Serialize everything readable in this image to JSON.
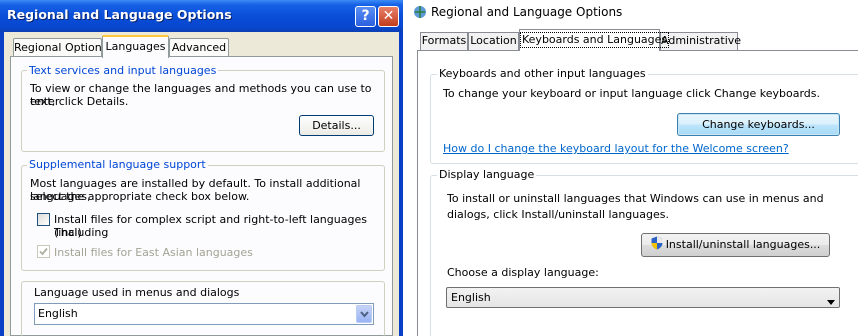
{
  "left_window": {
    "title": "Regional and Language Options",
    "help_label": "?",
    "close_label": "✕",
    "tabs": [
      {
        "label": "Regional Options"
      },
      {
        "label": "Languages"
      },
      {
        "label": "Advanced"
      }
    ],
    "text_services": {
      "legend": "Text services and input languages",
      "description_line1": "To view or change the languages and methods you can use to enter",
      "description_line2": "text, click Details.",
      "details_button": "Details..."
    },
    "supplemental": {
      "legend": "Supplemental language support",
      "description_line1": "Most languages are installed by default. To install additional languages,",
      "description_line2": "select the appropriate check box below.",
      "complex_script_line1": "Install files for complex script and right-to-left languages (including",
      "complex_script_line2": "Thai)",
      "complex_script_checked": false,
      "east_asian": "Install files for East Asian languages",
      "east_asian_checked": true,
      "east_asian_enabled": false
    },
    "menus_language": {
      "label": "Language used in menus and dialogs",
      "selected": "English"
    }
  },
  "right_window": {
    "title": "Regional and Language Options",
    "tabs": [
      {
        "label": "Formats"
      },
      {
        "label": "Location"
      },
      {
        "label": "Keyboards and Languages"
      },
      {
        "label": "Administrative"
      }
    ],
    "keyboards": {
      "legend": "Keyboards and other input languages",
      "description": "To change your keyboard or input language click Change keyboards.",
      "change_button": "Change keyboards...",
      "help_link": "How do I change the keyboard layout for the Welcome screen?"
    },
    "display_language": {
      "legend": "Display language",
      "description_line1": "To install or uninstall languages that Windows can use in menus and",
      "description_line2": "dialogs, click Install/uninstall languages.",
      "install_button": "Install/uninstall languages...",
      "choose_label": "Choose a display language:",
      "selected": "English"
    }
  },
  "colors": {
    "xp_title_blue": "#0a4ed8",
    "xp_legend_blue": "#0046d5",
    "xp_face": "#ece9d8",
    "vista_link": "#0066cc"
  },
  "icons": [
    "help-icon",
    "close-icon",
    "app-icon",
    "shield-icon",
    "chevron-down-icon",
    "checkmark-icon"
  ]
}
